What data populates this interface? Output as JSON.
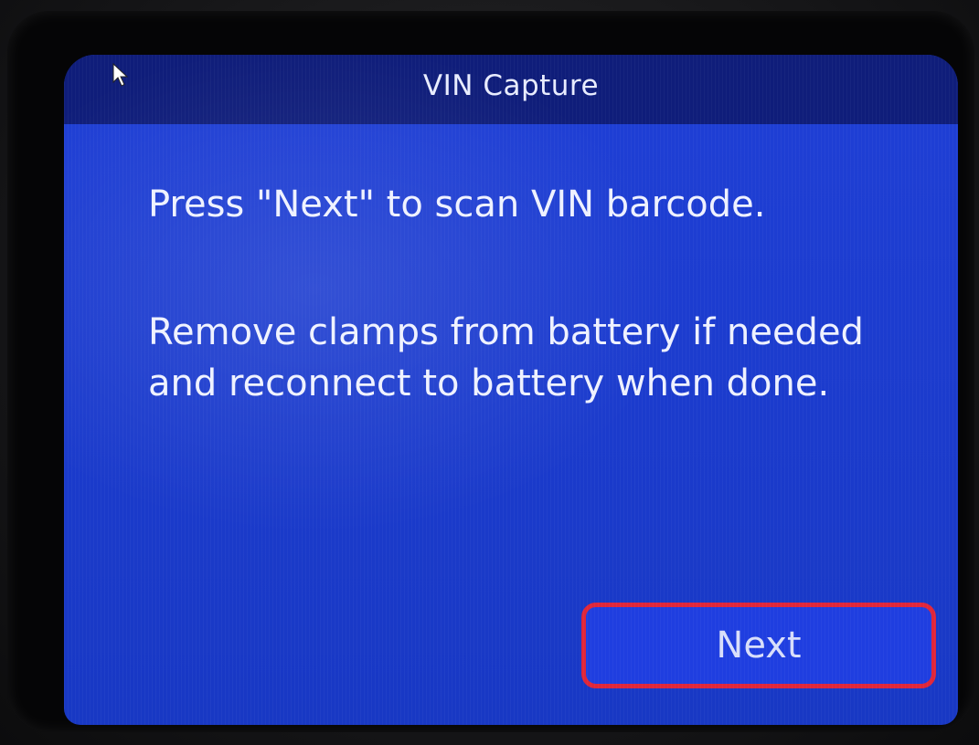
{
  "screen": {
    "title": "VIN Capture",
    "instruction_1": "Press \"Next\" to scan VIN barcode.",
    "instruction_2": "Remove clamps from battery if needed and reconnect to battery when done."
  },
  "actions": {
    "next_label": "Next"
  },
  "icons": {
    "cursor": "mouse-pointer-icon"
  },
  "colors": {
    "screen_background": "#1c3ccf",
    "title_bar": "#0f1d7a",
    "text": "#eef1ff",
    "button_highlight": "#e0263a"
  }
}
